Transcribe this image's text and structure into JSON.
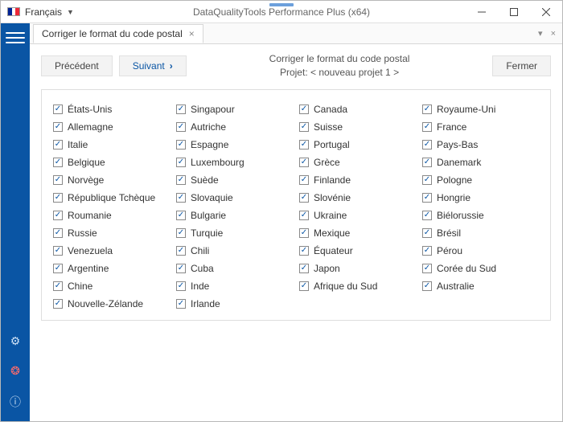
{
  "titlebar": {
    "language": "Français",
    "app_title": "DataQualityTools Performance Plus (x64)"
  },
  "tab": {
    "label": "Corriger le format du code postal"
  },
  "toolbar": {
    "prev_label": "Précédent",
    "next_label": "Suivant",
    "close_label": "Fermer",
    "heading": "Corriger le format du code postal",
    "project_line": "Projet: < nouveau projet 1 >"
  },
  "countries": {
    "col1": [
      "États-Unis",
      "Allemagne",
      "Italie",
      "Belgique",
      "Norvège",
      "République Tchèque",
      "Roumanie",
      "Russie",
      "Venezuela",
      "Argentine",
      "Chine",
      "Nouvelle-Zélande"
    ],
    "col2": [
      "Singapour",
      "Autriche",
      "Espagne",
      "Luxembourg",
      "Suède",
      "Slovaquie",
      "Bulgarie",
      "Turquie",
      "Chili",
      "Cuba",
      "Inde",
      "Irlande"
    ],
    "col3": [
      "Canada",
      "Suisse",
      "Portugal",
      "Grèce",
      "Finlande",
      "Slovénie",
      "Ukraine",
      "Mexique",
      "Équateur",
      "Japon",
      "Afrique du Sud"
    ],
    "col4": [
      "Royaume-Uni",
      "France",
      "Pays-Bas",
      "Danemark",
      "Pologne",
      "Hongrie",
      "Biélorussie",
      "Brésil",
      "Pérou",
      "Corée du Sud",
      "Australie"
    ]
  },
  "flag_colors": {
    "c1": "#002395",
    "c2": "#ffffff",
    "c3": "#ED2939"
  }
}
